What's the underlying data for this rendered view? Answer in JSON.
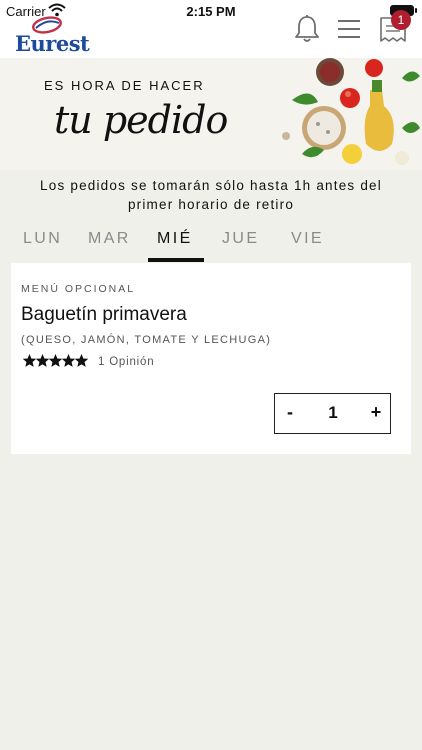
{
  "status_bar": {
    "carrier": "Carrier",
    "time": "2:15 PM"
  },
  "header": {
    "logo_text": "Eurest",
    "cart_count": "1",
    "icons": [
      "bell-icon",
      "menu-icon",
      "receipt-icon"
    ],
    "colors": {
      "brand_blue": "#1e4a9b",
      "brand_red": "#c2304a",
      "badge": "#b01e2f"
    }
  },
  "banner": {
    "kicker": "ES HORA DE HACER",
    "script": "tu pedido"
  },
  "notice": {
    "line1": "Los pedidos se tomarán sólo hasta 1h antes del",
    "line2": "primer horario de retiro"
  },
  "tabs": [
    {
      "label": "LUN",
      "active": false
    },
    {
      "label": "MAR",
      "active": false
    },
    {
      "label": "MIÉ",
      "active": true
    },
    {
      "label": "JUE",
      "active": false
    },
    {
      "label": "VIE",
      "active": false
    }
  ],
  "menu_item": {
    "category": "MENÚ OPCIONAL",
    "title": "Baguetín primavera",
    "description": "(QUESO, JAMÓN, TOMATE Y LECHUGA)",
    "rating": 5,
    "rating_max": 5,
    "reviews": "1 Opinión",
    "quantity": "1",
    "minus_label": "-",
    "plus_label": "+"
  }
}
